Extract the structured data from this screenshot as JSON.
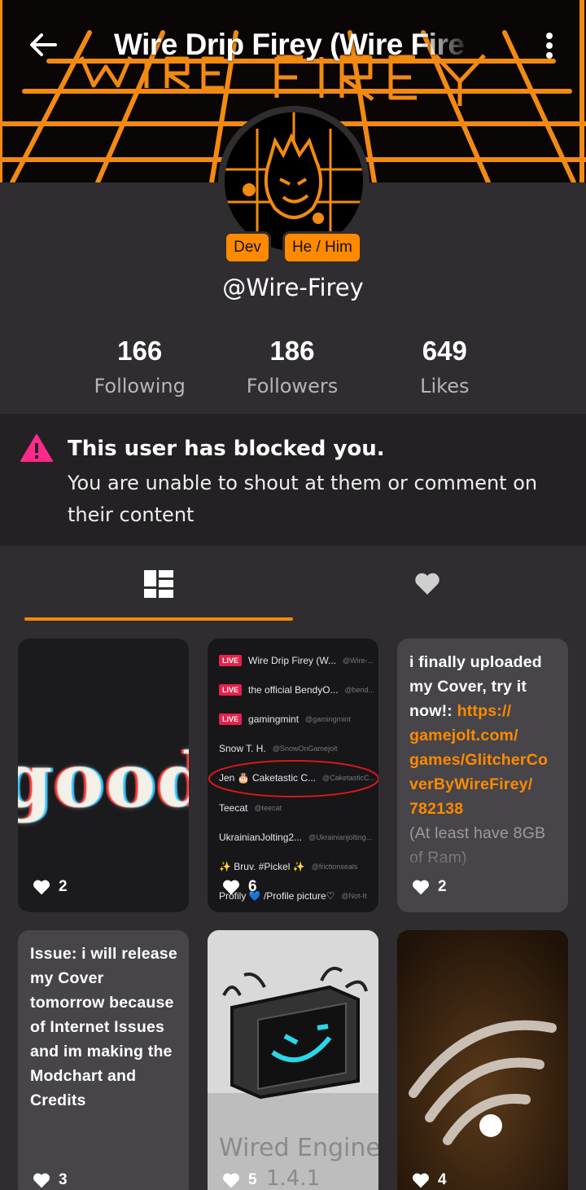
{
  "header": {
    "title": "Wire Drip Firey (Wire Fire",
    "banner_text": "WIRE FIREY"
  },
  "profile": {
    "badges": [
      "Dev",
      "He / Him"
    ],
    "username": "@Wire-Firey"
  },
  "stats": [
    {
      "value": "166",
      "label": "Following"
    },
    {
      "value": "186",
      "label": "Followers"
    },
    {
      "value": "649",
      "label": "Likes"
    }
  ],
  "notice": {
    "title": "This user has blocked you.",
    "body": "You are unable to shout at them or comment on their content"
  },
  "tabs": {
    "posts_icon": "grid-icon",
    "likes_icon": "heart-icon"
  },
  "posts": [
    {
      "image_text": "good",
      "likes": "2"
    },
    {
      "likes": "6",
      "list": [
        {
          "live": "LIVE",
          "name": "Wire Drip Firey (W...",
          "handle": "@Wire-..."
        },
        {
          "live": "LIVE",
          "name": "the official BendyO...",
          "handle": "@bend..."
        },
        {
          "live": "LIVE",
          "name": "gamingmint",
          "handle": "@gamingmint"
        },
        {
          "live": "",
          "name": "Snow T. H.",
          "handle": "@SnowOnGamejolt"
        },
        {
          "live": "",
          "name": "Jen 🎂 Caketastic C...",
          "handle": "@CaketasticC..."
        },
        {
          "live": "",
          "name": "Teecat",
          "handle": "@teecat"
        },
        {
          "live": "",
          "name": "UkrainianJolting2...",
          "handle": "@Ukrainianjolting..."
        },
        {
          "live": "",
          "name": "✨ Bruv. #Pickel ✨",
          "handle": "@frictionseals"
        },
        {
          "live": "",
          "name": "Profily 💙 /Profile picture♡",
          "handle": "@Not-It"
        }
      ]
    },
    {
      "likes": "2",
      "text_start": "i finally uploaded my Cover, try it now!: ",
      "link": "https:// gamejolt.com/ games/GlitcherCo verByWireFirey/ 782138",
      "text_end": "(At least have 8GB of Ram)"
    },
    {
      "likes": "3",
      "text": "Issue: i will release my Cover tomorrow because of Internet Issues and im making the Modchart and Credits"
    },
    {
      "likes": "5",
      "image_title": "Wired Engine",
      "image_version": "1.4.1"
    },
    {
      "likes": "4"
    }
  ],
  "colors": {
    "accent": "#ff8a00",
    "background": "#2f2d30",
    "notice_bg": "#232123",
    "warning": "#ff2a8a"
  }
}
